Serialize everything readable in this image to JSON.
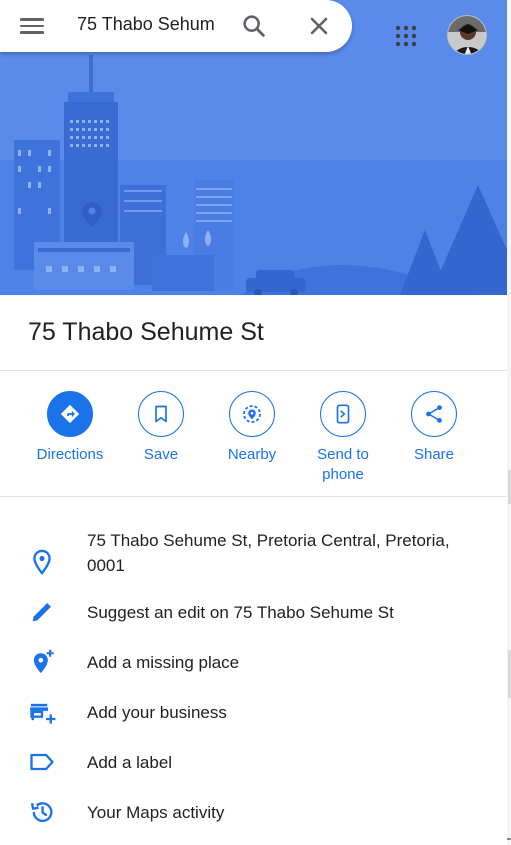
{
  "search": {
    "query": "75 Thabo Sehum"
  },
  "place": {
    "title": "75 Thabo Sehume St"
  },
  "actions": [
    {
      "label": "Directions",
      "icon": "directions-icon"
    },
    {
      "label": "Save",
      "icon": "bookmark-icon"
    },
    {
      "label": "Nearby",
      "icon": "nearby-icon"
    },
    {
      "label": "Send to\nphone",
      "icon": "send-to-phone-icon"
    },
    {
      "label": "Share",
      "icon": "share-icon"
    }
  ],
  "info": [
    {
      "text": "75 Thabo Sehume St, Pretoria Central, Pretoria, 0001",
      "icon": "location-pin-icon"
    },
    {
      "text": "Suggest an edit on 75 Thabo Sehume St",
      "icon": "pencil-icon"
    },
    {
      "text": "Add a missing place",
      "icon": "add-location-icon"
    },
    {
      "text": "Add your business",
      "icon": "add-business-icon"
    },
    {
      "text": "Add a label",
      "icon": "label-icon"
    },
    {
      "text": "Your Maps activity",
      "icon": "history-icon"
    }
  ],
  "colors": {
    "accent": "#1a73e8",
    "hero_bg": "#4f82e6"
  }
}
